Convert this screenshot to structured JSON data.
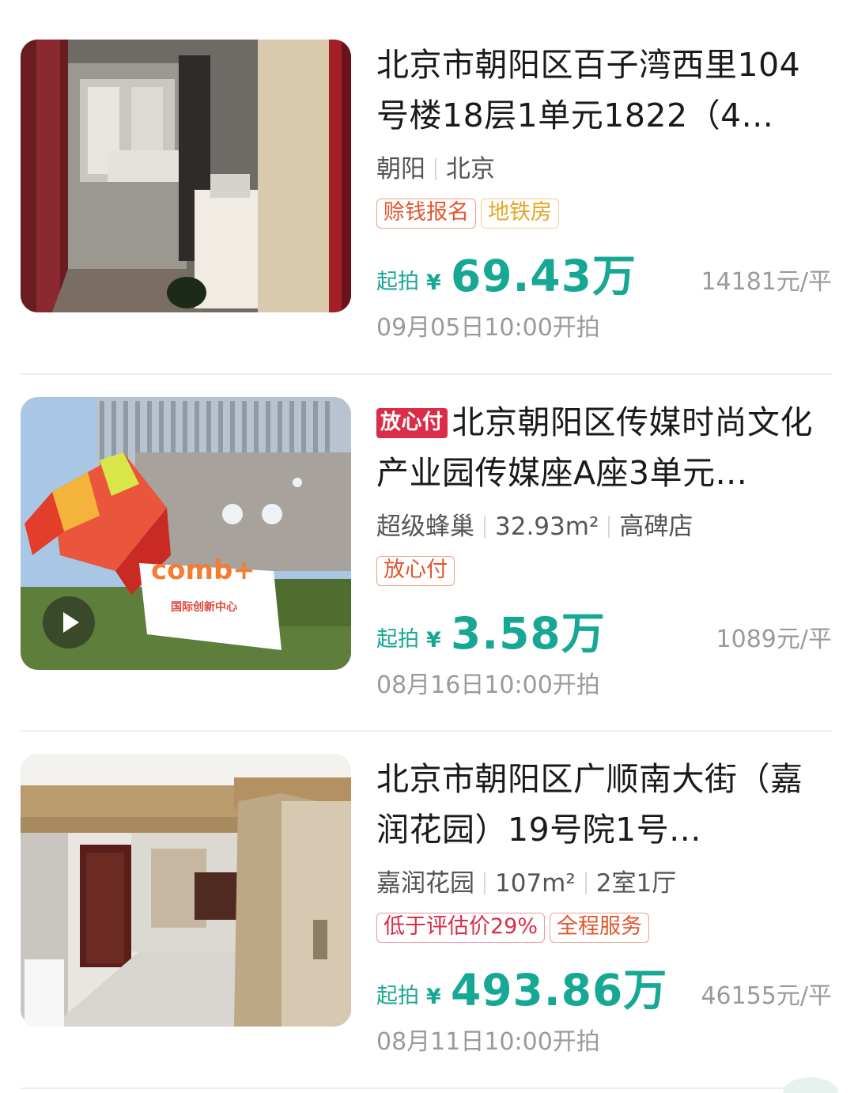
{
  "listings": [
    {
      "title": "北京市朝阳区百子湾西里104号楼18层1单元1822（4...",
      "badge": "",
      "meta": [
        "朝阳",
        "北京"
      ],
      "tags": [
        {
          "text": "赊钱报名",
          "color": "#e2562d"
        },
        {
          "text": "地铁房",
          "color": "#e5a72a"
        }
      ],
      "price_label": "起拍",
      "currency": "¥",
      "price": "69.43万",
      "unit_price": "14181元/平",
      "start_time": "09月05日10:00开拍",
      "image": "apartment-interior-photo"
    },
    {
      "title": "北京朝阳区传媒时尚文化产业园传媒座A座3单元...",
      "badge": "放心付",
      "meta": [
        "超级蜂巢",
        "32.93m²",
        "高碑店"
      ],
      "tags": [
        {
          "text": "放心付",
          "color": "#e2562d"
        }
      ],
      "price_label": "起拍",
      "currency": "¥",
      "price": "3.58万",
      "unit_price": "1089元/平",
      "start_time": "08月16日10:00开拍",
      "image": "building-exterior-video",
      "has_video": true
    },
    {
      "title": "北京市朝阳区广顺南大街（嘉润花园）19号院1号...",
      "badge": "",
      "meta": [
        "嘉润花园",
        "107m²",
        "2室1厅"
      ],
      "tags": [
        {
          "text": "低于评估价29%",
          "color": "#d92d4a"
        },
        {
          "text": "全程服务",
          "color": "#e2562d"
        }
      ],
      "price_label": "起拍",
      "currency": "¥",
      "price": "493.86万",
      "unit_price": "46155元/平",
      "start_time": "08月11日10:00开拍",
      "image": "hallway-interior-photo"
    }
  ],
  "accent_color": "#16a894"
}
